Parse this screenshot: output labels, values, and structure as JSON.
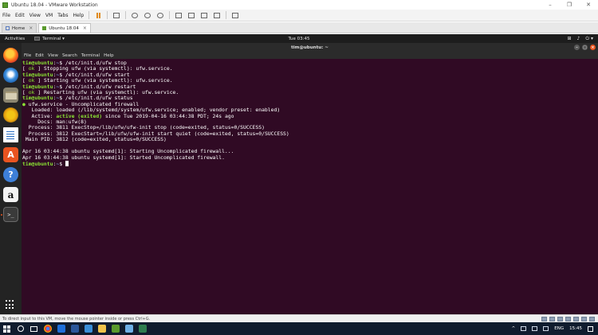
{
  "vmware": {
    "window_title": "Ubuntu 18.04 - VMware Workstation",
    "window_controls": [
      "–",
      "❐",
      "✕"
    ],
    "menu": [
      "File",
      "Edit",
      "View",
      "VM",
      "Tabs",
      "Help"
    ],
    "tabs": [
      {
        "label": "Home"
      },
      {
        "label": "Ubuntu 18.04"
      }
    ],
    "status_text": "To direct input to this VM, move the mouse pointer inside or press Ctrl+G."
  },
  "gnome": {
    "activities": "Activities",
    "app_menu": "Terminal ▾",
    "clock": "Tue 03:45",
    "tray": [
      "⊞",
      "♪",
      "⏻ ▾"
    ]
  },
  "dock": {
    "items": [
      "firefox-icon",
      "thunderbird-icon",
      "files-icon",
      "rhythmbox-icon",
      "writer-icon",
      "software-icon",
      "help-icon",
      "amazon-icon",
      "terminal-icon"
    ],
    "software_glyph": "A",
    "help_glyph": "?",
    "amazon_glyph": "a",
    "terminal_glyph": ">_"
  },
  "terminal": {
    "title": "tim@ubuntu: ~",
    "menu": [
      "File",
      "Edit",
      "View",
      "Search",
      "Terminal",
      "Help"
    ],
    "prompt_user": "tim@ubuntu",
    "prompt_path": "~",
    "lines": {
      "cmd1": "/etc/init.d/ufw stop",
      "out1_ok": "ok",
      "out1": "Stopping ufw (via systemctl): ufw.service.",
      "cmd2": "/etc/init.d/ufw start",
      "out2_ok": "ok",
      "out2": "Starting ufw (via systemctl): ufw.service.",
      "cmd3": "/etc/init.d/ufw restart",
      "out3_ok": "ok",
      "out3": "Restarting ufw (via systemctl): ufw.service.",
      "cmd4": "/etc/init.d/ufw status",
      "status_unit": "ufw.service - Uncomplicated firewall",
      "loaded": "   Loaded: loaded (/lib/systemd/system/ufw.service; enabled; vendor preset: enabled)",
      "active_label": "   Active: ",
      "active_state": "active (exited)",
      "active_rest": " since Tue 2019-04-16 03:44:38 PDT; 24s ago",
      "docs": "     Docs: man:ufw(8)",
      "process1": "  Process: 3811 ExecStop=/lib/ufw/ufw-init stop (code=exited, status=0/SUCCESS)",
      "process2": "  Process: 3812 ExecStart=/lib/ufw/ufw-init start quiet (code=exited, status=0/SUCCESS)",
      "mainpid": " Main PID: 3812 (code=exited, status=0/SUCCESS)",
      "log1": "Apr 16 03:44:38 ubuntu systemd[1]: Starting Uncomplicated firewall...",
      "log2": "Apr 16 03:44:38 ubuntu systemd[1]: Started Uncomplicated firewall."
    }
  },
  "taskbar": {
    "lang": "ENG",
    "time": "15:45"
  },
  "colors": {
    "terminal_bg": "#300a24",
    "prompt_green": "#8ae234",
    "path_blue": "#729fcf",
    "ubuntu_orange": "#e95420"
  }
}
